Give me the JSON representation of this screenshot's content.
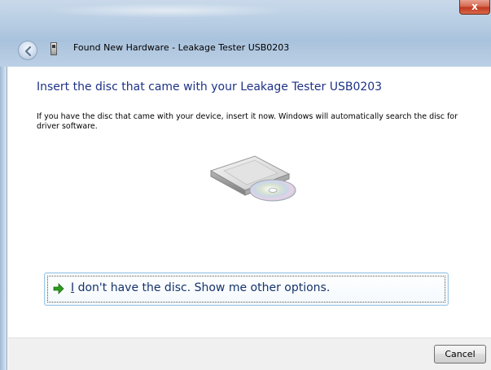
{
  "window": {
    "title": "Found New Hardware - Leakage Tester USB0203",
    "close_label": "x"
  },
  "main": {
    "heading": "Insert the disc that came with your Leakage Tester USB0203",
    "description": "If you have the disc that came with your device, insert it now.  Windows will automatically search the disc for driver software."
  },
  "option": {
    "mnemonic": "I",
    "label_rest": " don't have the disc.  Show me other options."
  },
  "footer": {
    "cancel_label": "Cancel"
  },
  "icons": {
    "back": "back-arrow-icon",
    "device": "usb-device-icon",
    "option_arrow": "green-arrow-icon",
    "illustration": "disc-drive-icon"
  },
  "colors": {
    "heading": "#1e3287",
    "link_text": "#15336b",
    "link_border": "#9ec7e6",
    "arrow": "#2e9a1f",
    "footer_bg": "#f0f0f0"
  }
}
